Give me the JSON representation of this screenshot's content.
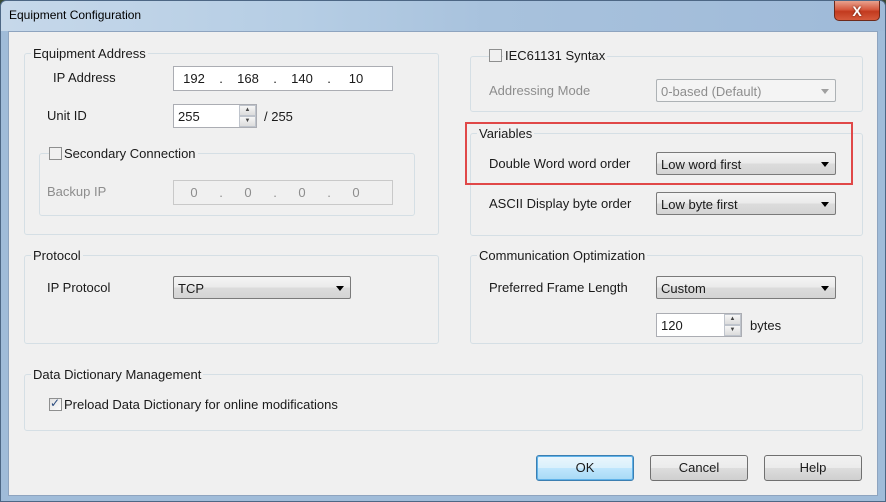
{
  "window": {
    "title": "Equipment Configuration",
    "close_label": "X"
  },
  "equipment_address": {
    "legend": "Equipment Address",
    "ip_label": "IP Address",
    "ip": [
      "192",
      "168",
      "140",
      "10"
    ],
    "unit_id_label": "Unit ID",
    "unit_id_value": "255",
    "unit_id_max": "/ 255",
    "secondary_label": "Secondary Connection",
    "secondary_checked": false,
    "backup_ip_label": "Backup IP",
    "backup_ip": [
      "0",
      "0",
      "0",
      "0"
    ]
  },
  "iec": {
    "label": "IEC61131 Syntax",
    "checked": false,
    "addressing_label": "Addressing Mode",
    "addressing_value": "0-based (Default)"
  },
  "variables": {
    "legend": "Variables",
    "dword_label": "Double Word word order",
    "dword_value": "Low word first",
    "ascii_label": "ASCII Display byte order",
    "ascii_value": "Low byte first"
  },
  "protocol": {
    "legend": "Protocol",
    "ip_protocol_label": "IP Protocol",
    "ip_protocol_value": "TCP"
  },
  "comm_opt": {
    "legend": "Communication Optimization",
    "frame_label": "Preferred Frame Length",
    "frame_value": "Custom",
    "bytes_value": "120",
    "bytes_label": "bytes"
  },
  "data_dict": {
    "legend": "Data Dictionary Management",
    "preload_label": "Preload Data Dictionary for online modifications",
    "preload_checked": true
  },
  "buttons": {
    "ok": "OK",
    "cancel": "Cancel",
    "help": "Help"
  },
  "colors": {
    "highlight": "#e04848",
    "default_button": "#3c7fb1"
  }
}
